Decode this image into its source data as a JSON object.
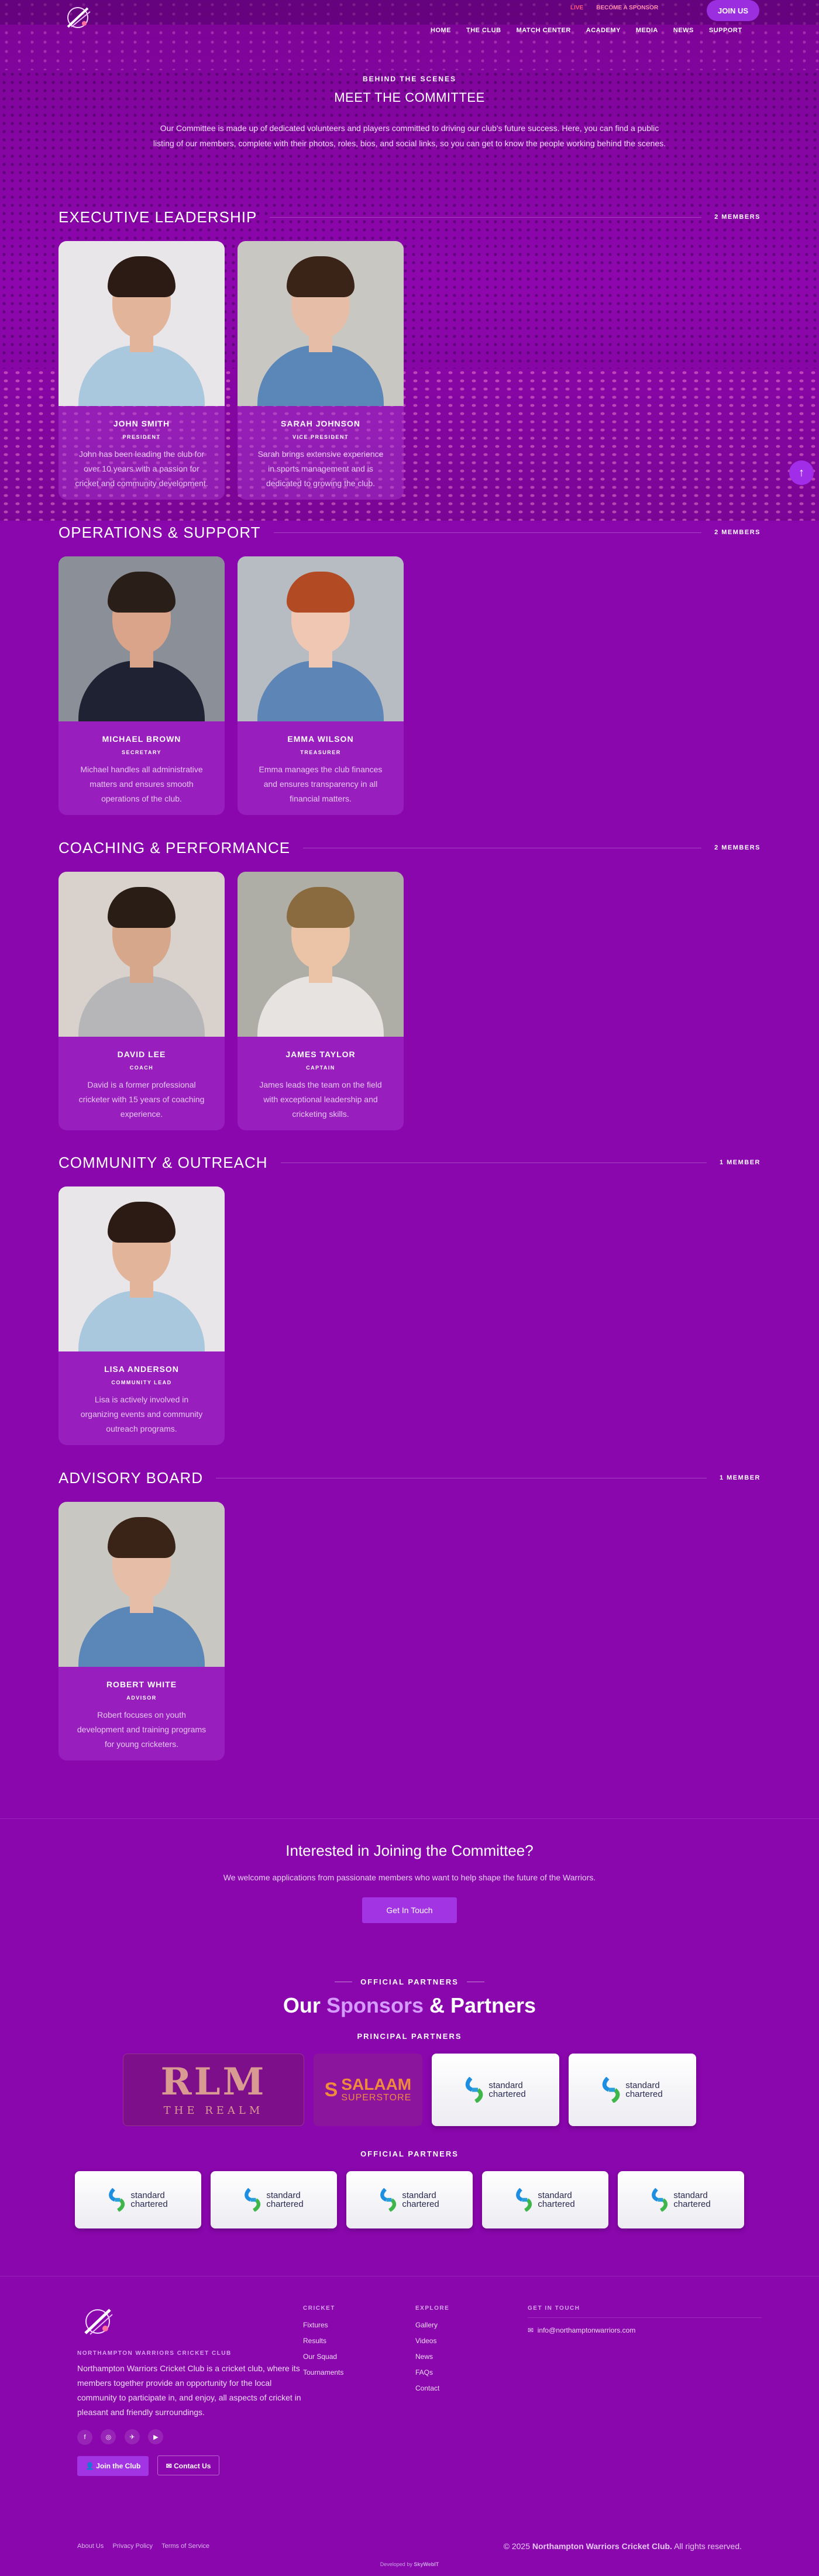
{
  "nav": {
    "links": [
      "HOME",
      "THE CLUB",
      "MATCH CENTER",
      "ACADEMY",
      "MEDIA",
      "NEWS",
      "SUPPORT"
    ],
    "live": "LIVE",
    "sponsor": "BECOME A SPONSOR",
    "join": "JOIN US"
  },
  "hero": {
    "eyebrow": "BEHIND THE SCENES",
    "title": "MEET THE COMMITTEE",
    "description": "Our Committee is made up of dedicated volunteers and players committed to driving our club's future success. Here, you can find a public listing of our members, complete with their photos, roles, bios, and social links, so you can get to know the people working behind the scenes."
  },
  "sections": [
    {
      "title": "EXECUTIVE LEADERSHIP",
      "count": "2 MEMBERS",
      "members": [
        {
          "name": "JOHN SMITH",
          "role": "PRESIDENT",
          "bio": "John has been leading the club for over 10 years with a passion for cricket and community development.",
          "photo": "man-white-shirt"
        },
        {
          "name": "SARAH JOHNSON",
          "role": "VICE PRESIDENT",
          "bio": "Sarah brings extensive experience in sports management and is dedicated to growing the club.",
          "photo": "woman-denim"
        }
      ]
    },
    {
      "title": "OPERATIONS & SUPPORT",
      "count": "2 MEMBERS",
      "members": [
        {
          "name": "MICHAEL BROWN",
          "role": "SECRETARY",
          "bio": "Michael handles all administrative matters and ensures smooth operations of the club.",
          "photo": "man-suit"
        },
        {
          "name": "EMMA WILSON",
          "role": "TREASURER",
          "bio": "Emma manages the club finances and ensures transparency in all financial matters.",
          "photo": "woman-redhair"
        }
      ]
    },
    {
      "title": "COACHING & PERFORMANCE",
      "count": "2 MEMBERS",
      "members": [
        {
          "name": "DAVID LEE",
          "role": "COACH",
          "bio": "David is a former professional cricketer with 15 years of coaching experience.",
          "photo": "man-glasses"
        },
        {
          "name": "JAMES TAYLOR",
          "role": "CAPTAIN",
          "bio": "James leads the team on the field with exceptional leadership and cricketing skills.",
          "photo": "woman-smile"
        }
      ]
    },
    {
      "title": "COMMUNITY & OUTREACH",
      "count": "1 MEMBER",
      "members": [
        {
          "name": "LISA ANDERSON",
          "role": "COMMUNITY LEAD",
          "bio": "Lisa is actively involved in organizing events and community outreach programs.",
          "photo": "man-white-shirt"
        }
      ]
    },
    {
      "title": "ADVISORY BOARD",
      "count": "1 MEMBER",
      "members": [
        {
          "name": "ROBERT WHITE",
          "role": "ADVISOR",
          "bio": "Robert focuses on youth development and training programs for young cricketers.",
          "photo": "woman-denim"
        }
      ]
    }
  ],
  "cta": {
    "title": "Interested in Joining the Committee?",
    "text": "We welcome applications from passionate members who want to help shape the future of the Warriors.",
    "button": "Get In Touch"
  },
  "partners": {
    "eyebrow": "OFFICIAL PARTNERS",
    "title_pre": "Our",
    "title_accent": "Sponsors",
    "title_post": "& Partners",
    "principal_label": "PRINCIPAL PARTNERS",
    "official_label": "OFFICIAL PARTNERS",
    "principal": [
      "RLM THE REALM",
      "SALAAM SUPERSTORE",
      "standard chartered",
      "standard chartered"
    ],
    "official": [
      "standard chartered",
      "standard chartered",
      "standard chartered",
      "standard chartered",
      "standard chartered"
    ],
    "rlm_main": "RLM",
    "rlm_sub": "THE REALM",
    "salaam_main": "SALAAM",
    "salaam_sub": "SUPERSTORE",
    "sc_line1": "standard",
    "sc_line2": "chartered"
  },
  "footer": {
    "club_name": "NORTHAMPTON WARRIORS CRICKET CLUB",
    "about": "Northampton Warriors Cricket Club is a cricket club, where its members together provide an opportunity for the local community to participate in, and enjoy, all aspects of cricket in pleasant and friendly surroundings.",
    "socials": [
      "f",
      "◎",
      "✈",
      "▶"
    ],
    "join_button": "Join the Club",
    "contact_button": "Contact Us",
    "cricket_title": "CRICKET",
    "cricket_links": [
      "Fixtures",
      "Results",
      "Our Squad",
      "Tournaments"
    ],
    "explore_title": "EXPLORE",
    "explore_links": [
      "Gallery",
      "Videos",
      "News",
      "FAQs",
      "Contact"
    ],
    "touch_title": "GET IN TOUCH",
    "email": "info@northamptonwarriors.com",
    "bottom_links": [
      "About Us",
      "Privacy Policy",
      "Terms of Service"
    ],
    "copyright_pre": "© 2025",
    "copyright_name": "Northampton Warriors Cricket Club.",
    "copyright_post": "All rights reserved.",
    "developed_pre": "Developed by",
    "developed_name": "SkyWebIT"
  },
  "colors": {
    "background": "#8a06ad",
    "accent": "#a234e4",
    "card": "#9c2fc2",
    "sponsor_accent": "#d59bff"
  }
}
